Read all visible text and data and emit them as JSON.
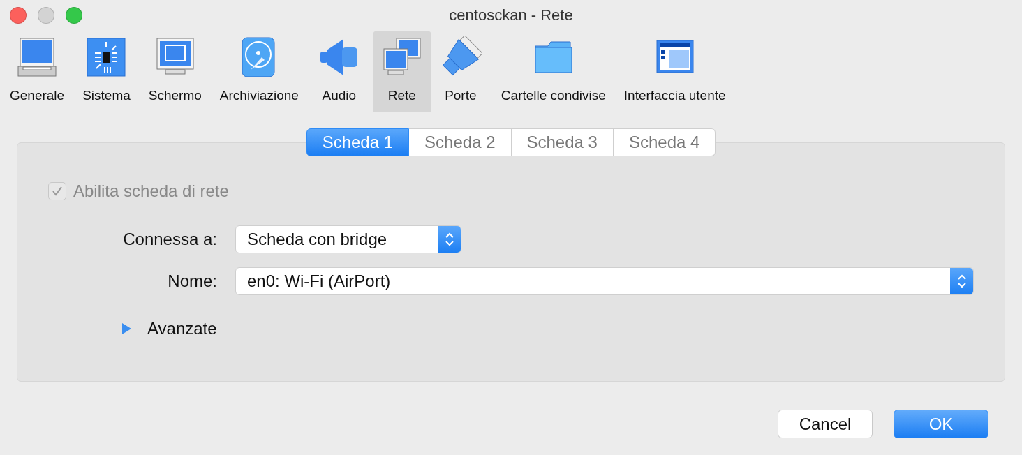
{
  "window": {
    "title": "centosckan - Rete"
  },
  "toolbar": [
    {
      "kind": "general",
      "label": "Generale",
      "selected": false
    },
    {
      "kind": "system",
      "label": "Sistema",
      "selected": false
    },
    {
      "kind": "display",
      "label": "Schermo",
      "selected": false
    },
    {
      "kind": "storage",
      "label": "Archiviazione",
      "selected": false
    },
    {
      "kind": "audio",
      "label": "Audio",
      "selected": false
    },
    {
      "kind": "network",
      "label": "Rete",
      "selected": true
    },
    {
      "kind": "ports",
      "label": "Porte",
      "selected": false
    },
    {
      "kind": "folders",
      "label": "Cartelle condivise",
      "selected": false
    },
    {
      "kind": "ui",
      "label": "Interfaccia utente",
      "selected": false
    }
  ],
  "tabs": [
    {
      "label": "Scheda 1",
      "selected": true
    },
    {
      "label": "Scheda 2",
      "selected": false
    },
    {
      "label": "Scheda 3",
      "selected": false
    },
    {
      "label": "Scheda 4",
      "selected": false
    }
  ],
  "enable_adapter": {
    "label": "Abilita scheda di rete",
    "checked": true,
    "disabled": true
  },
  "attached_to": {
    "label": "Connessa a:",
    "value": "Scheda con bridge"
  },
  "name": {
    "label": "Nome:",
    "value": "en0: Wi-Fi (AirPort)"
  },
  "advanced": {
    "label": "Avanzate",
    "expanded": false
  },
  "buttons": [
    {
      "label": "Cancel",
      "kind": "secondary"
    },
    {
      "label": "OK",
      "kind": "primary"
    }
  ]
}
